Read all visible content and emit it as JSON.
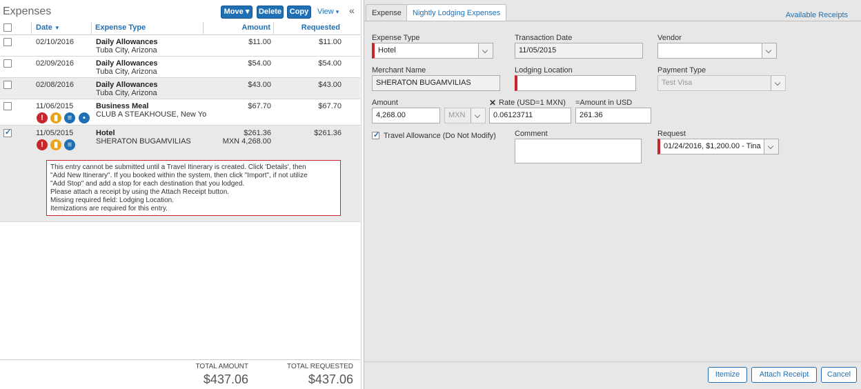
{
  "left": {
    "title": "Expenses",
    "toolbar": {
      "move": "Move",
      "delete": "Delete",
      "copy": "Copy",
      "view": "View",
      "collapse": "«"
    },
    "columns": {
      "date": "Date",
      "expense_type": "Expense Type",
      "amount": "Amount",
      "requested": "Requested"
    },
    "rows": [
      {
        "date": "02/10/2016",
        "type": "Daily Allowances",
        "sub": "Tuba City, Arizona",
        "amount": "$11.00",
        "requested": "$11.00"
      },
      {
        "date": "02/09/2016",
        "type": "Daily Allowances",
        "sub": "Tuba City, Arizona",
        "amount": "$54.00",
        "requested": "$54.00"
      },
      {
        "date": "02/08/2016",
        "type": "Daily Allowances",
        "sub": "Tuba City, Arizona",
        "amount": "$43.00",
        "requested": "$43.00"
      },
      {
        "date": "11/06/2015",
        "type": "Business Meal",
        "sub": "CLUB A STEAKHOUSE, New Yo",
        "amount": "$67.70",
        "requested": "$67.70"
      },
      {
        "date": "11/05/2015",
        "type": "Hotel",
        "sub": "SHERATON BUGAMVILIAS",
        "amount": "$261.36",
        "amount2": "MXN 4,268.00",
        "requested": "$261.36"
      }
    ],
    "error_lines": [
      "This entry cannot be submitted until a Travel Itinerary is created. Click 'Details', then",
      "\"Add New Itinerary\". If you booked within the system, then click \"Import\", if not utilize",
      "\"Add Stop\" and add a stop for each destination that you lodged.",
      "Please attach a receipt by using the Attach Receipt button.",
      "Missing required field: Lodging Location.",
      "Itemizations are required for this entry."
    ],
    "totals": {
      "amount_label": "TOTAL AMOUNT",
      "amount_value": "$437.06",
      "requested_label": "TOTAL REQUESTED",
      "requested_value": "$437.06"
    }
  },
  "right": {
    "tabs": {
      "expense": "Expense",
      "nightly": "Nightly Lodging Expenses"
    },
    "available_receipts": "Available Receipts",
    "fields": {
      "expense_type": {
        "label": "Expense Type",
        "value": "Hotel"
      },
      "transaction_date": {
        "label": "Transaction Date",
        "value": "11/05/2015"
      },
      "vendor": {
        "label": "Vendor",
        "value": ""
      },
      "merchant_name": {
        "label": "Merchant Name",
        "value": "SHERATON BUGAMVILIAS"
      },
      "lodging_location": {
        "label": "Lodging Location",
        "value": ""
      },
      "payment_type": {
        "label": "Payment Type",
        "value": "Test Visa"
      },
      "amount": {
        "label": "Amount",
        "value": "4,268.00"
      },
      "currency": {
        "value": "MXN"
      },
      "rate": {
        "label": "Rate (USD=1 MXN)",
        "value": "0.06123711"
      },
      "amount_usd": {
        "label": "=Amount in USD",
        "value": "261.36"
      },
      "travel_allowance": {
        "label": "Travel Allowance (Do Not Modify)"
      },
      "comment": {
        "label": "Comment",
        "value": ""
      },
      "request": {
        "label": "Request",
        "value": "01/24/2016, $1,200.00 - Tina"
      }
    },
    "buttons": {
      "itemize": "Itemize",
      "attach_receipt": "Attach Receipt",
      "cancel": "Cancel"
    }
  }
}
